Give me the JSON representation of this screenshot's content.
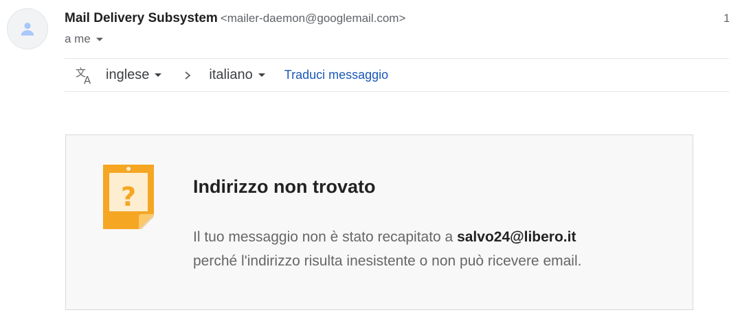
{
  "email": {
    "sender_name": "Mail Delivery Subsystem",
    "sender_email": "<mailer-daemon@googlemail.com>",
    "date_partial": "1",
    "recipient": "a me"
  },
  "translate": {
    "source_language": "inglese",
    "target_language": "italiano",
    "action_label": "Traduci messaggio"
  },
  "bounce": {
    "title": "Indirizzo non trovato",
    "message_before": "Il tuo messaggio non è stato recapitato a ",
    "address": "salvo24@libero.it",
    "message_after": "perché l'indirizzo risulta inesistente o non può ricevere email."
  },
  "icons": {
    "avatar": "person-icon",
    "translate": "translate-icon",
    "arrow": "chevron-right-icon",
    "bounce": "question-note-icon"
  },
  "colors": {
    "link": "#1a57b8",
    "note_orange": "#f5a623",
    "card_background": "#f8f8f8"
  }
}
